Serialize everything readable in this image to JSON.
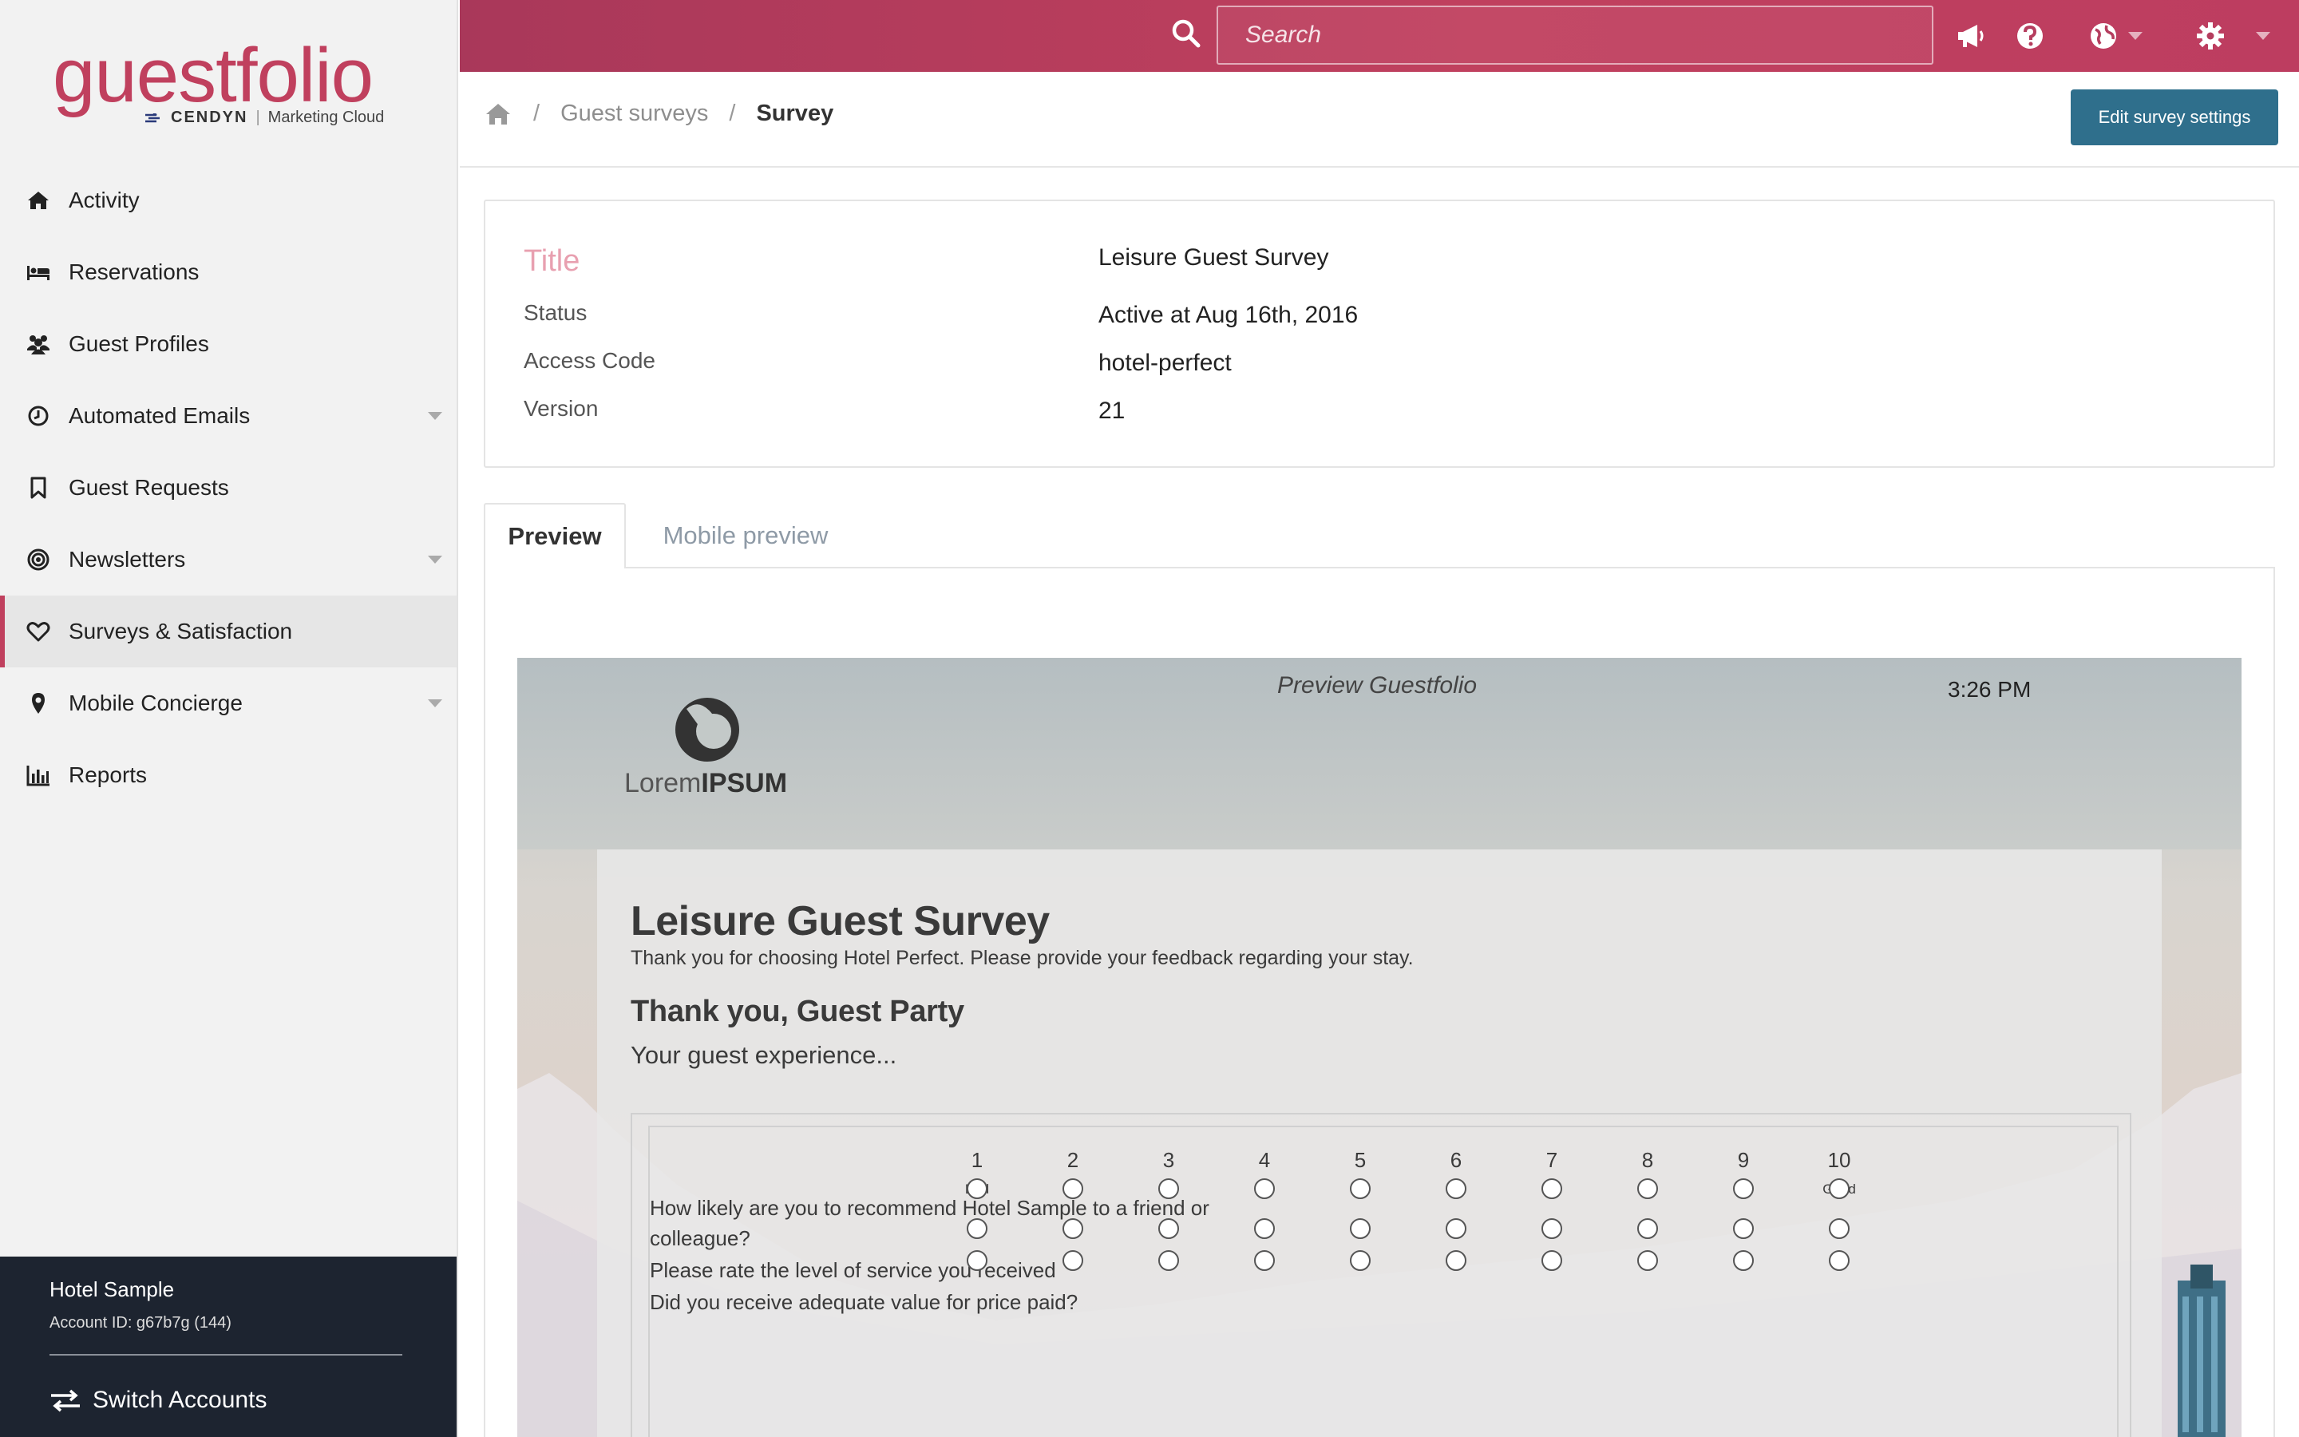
{
  "brand": {
    "logo_text": "guestfolio",
    "company": "CENDYN",
    "separator": "|",
    "suite": "Marketing Cloud",
    "accent_color": "#c0405e"
  },
  "sidebar": {
    "items": [
      {
        "label": "Activity",
        "icon": "home-icon"
      },
      {
        "label": "Reservations",
        "icon": "bed-icon"
      },
      {
        "label": "Guest Profiles",
        "icon": "users-icon"
      },
      {
        "label": "Automated Emails",
        "icon": "clock-icon",
        "has_submenu": true
      },
      {
        "label": "Guest Requests",
        "icon": "bookmark-icon"
      },
      {
        "label": "Newsletters",
        "icon": "target-icon",
        "has_submenu": true
      },
      {
        "label": "Surveys & Satisfaction",
        "icon": "heart-icon",
        "active": true
      },
      {
        "label": "Mobile Concierge",
        "icon": "map-pin-icon",
        "has_submenu": true
      },
      {
        "label": "Reports",
        "icon": "bar-chart-icon"
      }
    ]
  },
  "account": {
    "hotel_name": "Hotel Sample",
    "account_id": "Account ID: g67b7g (144)",
    "switch_label": "Switch Accounts"
  },
  "topbar": {
    "search_placeholder": "Search",
    "icons": [
      "search-icon",
      "megaphone-icon",
      "help-icon",
      "globe-icon",
      "gear-icon"
    ]
  },
  "breadcrumb": {
    "items": [
      "Guest surveys",
      "Survey"
    ],
    "separator": "/",
    "edit_button": "Edit survey settings"
  },
  "info": {
    "title_label": "Title",
    "title_value": "Leisure Guest Survey",
    "status_label": "Status",
    "status_value": "Active at Aug 16th, 2016",
    "access_label": "Access Code",
    "access_value": "hotel-perfect",
    "version_label": "Version",
    "version_value": "21"
  },
  "tabs": {
    "preview": "Preview",
    "mobile_preview": "Mobile preview"
  },
  "preview": {
    "logo_light": "Lorem",
    "logo_bold": "IPSUM",
    "header_title": "Preview Guestfolio",
    "time": "3:26 PM",
    "survey_title": "Leisure Guest Survey",
    "intro": "Thank you for choosing Hotel Perfect. Please provide your feedback regarding your stay.",
    "greeting": "Thank you, Guest Party",
    "section": "Your guest experience...",
    "scale": [
      "1",
      "2",
      "3",
      "4",
      "5",
      "6",
      "7",
      "8",
      "9",
      "10"
    ],
    "scale_low": "Bad",
    "scale_high": "Good",
    "questions": [
      "How likely are you to recommend Hotel Sample to a friend or colleague?",
      "Please rate the level of service you received",
      "Did you receive adequate value for price paid?"
    ]
  }
}
